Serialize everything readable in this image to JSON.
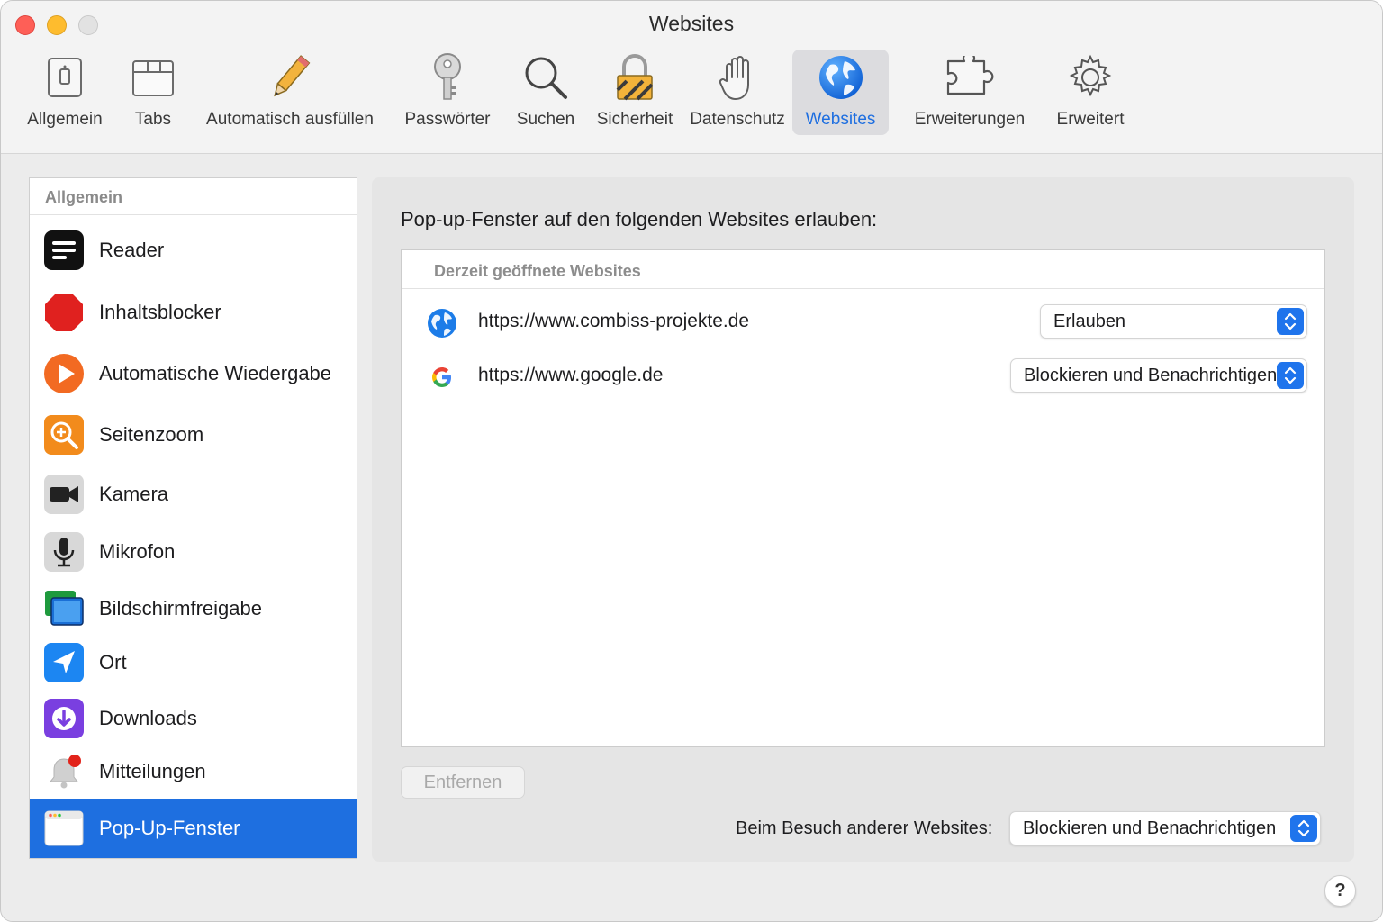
{
  "window": {
    "title": "Websites"
  },
  "toolbar": {
    "items": [
      {
        "label": "Allgemein",
        "icon": "general-switch-icon"
      },
      {
        "label": "Tabs",
        "icon": "tabs-icon"
      },
      {
        "label": "Automatisch ausfüllen",
        "icon": "pencil-icon"
      },
      {
        "label": "Passwörter",
        "icon": "key-icon"
      },
      {
        "label": "Suchen",
        "icon": "magnifier-icon"
      },
      {
        "label": "Sicherheit",
        "icon": "lock-icon"
      },
      {
        "label": "Datenschutz",
        "icon": "hand-icon"
      },
      {
        "label": "Websites",
        "icon": "globe-icon",
        "active": true
      },
      {
        "label": "Erweiterungen",
        "icon": "puzzle-icon"
      },
      {
        "label": "Erweitert",
        "icon": "gear-icon"
      }
    ]
  },
  "sidebar": {
    "header": "Allgemein",
    "items": [
      {
        "label": "Reader",
        "icon": "reader-icon"
      },
      {
        "label": "Inhaltsblocker",
        "icon": "stop-sign-icon"
      },
      {
        "label": "Automatische Wiedergabe",
        "icon": "play-icon"
      },
      {
        "label": "Seitenzoom",
        "icon": "zoom-icon"
      },
      {
        "label": "Kamera",
        "icon": "camera-icon"
      },
      {
        "label": "Mikrofon",
        "icon": "microphone-icon"
      },
      {
        "label": "Bildschirmfreigabe",
        "icon": "screen-share-icon"
      },
      {
        "label": "Ort",
        "icon": "location-icon"
      },
      {
        "label": "Downloads",
        "icon": "download-icon"
      },
      {
        "label": "Mitteilungen",
        "icon": "notification-bell-icon"
      },
      {
        "label": "Pop-Up-Fenster",
        "icon": "popup-window-icon",
        "selected": true
      }
    ]
  },
  "main": {
    "heading": "Pop-up-Fenster auf den folgenden Websites erlauben:",
    "table_header": "Derzeit geöffnete Websites",
    "rows": [
      {
        "url": "https://www.combiss-projekte.de",
        "icon": "globe-icon",
        "setting": "Erlauben"
      },
      {
        "url": "https://www.google.de",
        "icon": "google-logo-icon",
        "setting": "Blockieren und Benachrichtigen"
      }
    ],
    "remove_button": "Entfernen",
    "other_websites_label": "Beim Besuch anderer Websites:",
    "other_websites_value": "Blockieren und Benachrichtigen"
  },
  "help": {
    "label": "?"
  },
  "colors": {
    "accent": "#1e6fe0",
    "selected_label": "#1f6fe0"
  }
}
